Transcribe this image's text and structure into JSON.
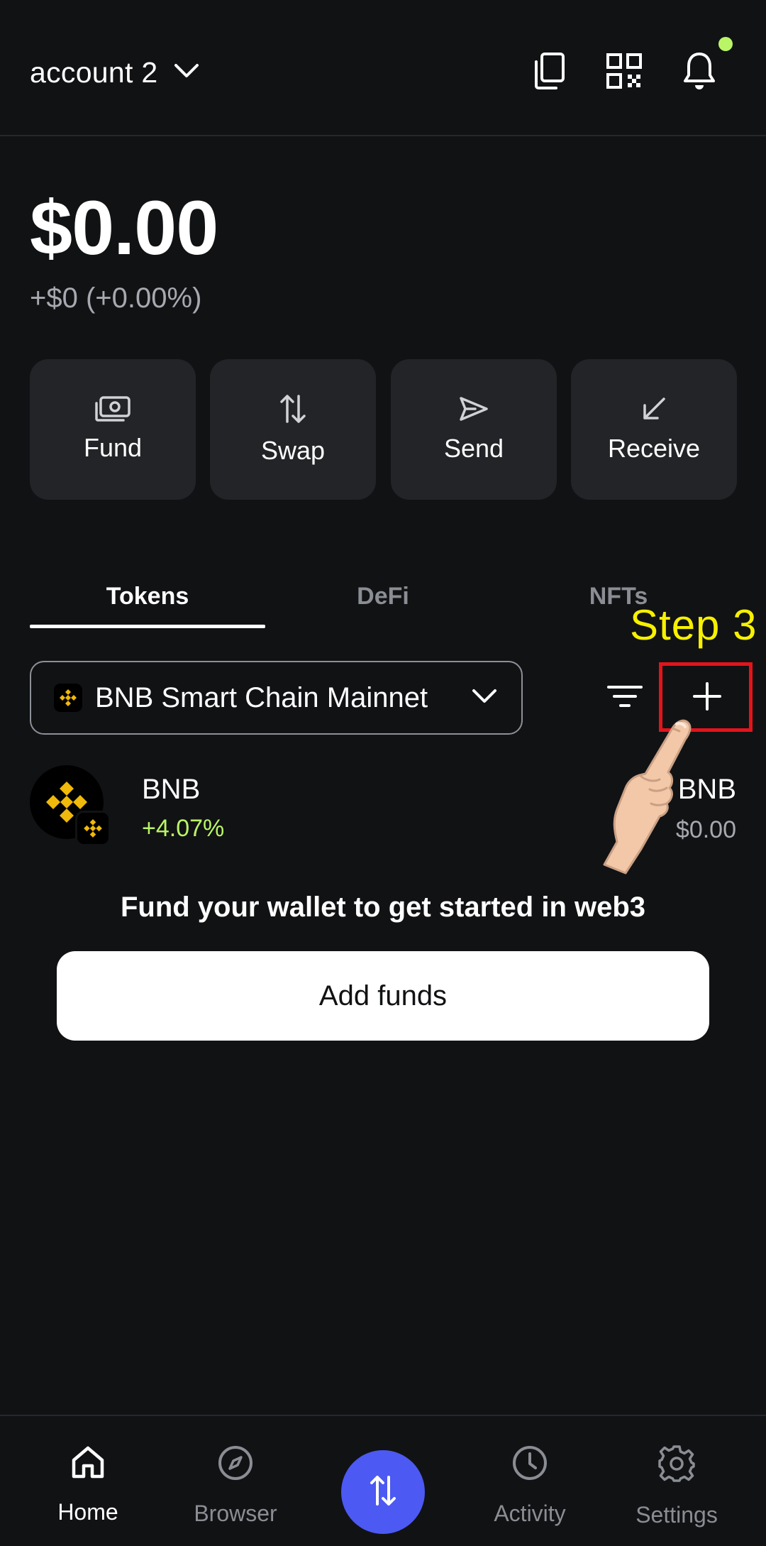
{
  "header": {
    "account_name": "account 2",
    "icons": [
      "chevron-down-icon",
      "copy-icon",
      "qr-code-icon",
      "bell-icon"
    ],
    "notification_dot_color": "#b9f566"
  },
  "balance": {
    "total": "$0.00",
    "change": "+$0 (+0.00%)"
  },
  "actions": [
    {
      "label": "Fund",
      "icon": "money-icon"
    },
    {
      "label": "Swap",
      "icon": "swap-arrows-icon"
    },
    {
      "label": "Send",
      "icon": "send-icon"
    },
    {
      "label": "Receive",
      "icon": "receive-arrow-icon"
    }
  ],
  "tabs": [
    {
      "label": "Tokens",
      "active": true
    },
    {
      "label": "DeFi",
      "active": false
    },
    {
      "label": "NFTs",
      "active": false
    }
  ],
  "network": {
    "name": "BNB Smart Chain Mainnet",
    "icon": "bnb-icon"
  },
  "toolbar": {
    "icons": [
      "filter-icon",
      "plus-icon"
    ]
  },
  "annotation": {
    "step_label": "Step 3",
    "highlight_color": "#e4141b",
    "label_color": "#f7f000"
  },
  "tokens": [
    {
      "symbol": "BNB",
      "change": "+4.07%",
      "balance": "BNB",
      "fiat": "$0.00",
      "change_color": "#b9f566"
    }
  ],
  "empty_state": {
    "prompt": "Fund your wallet to get started in web3",
    "button_label": "Add funds"
  },
  "bottom_nav": {
    "items": [
      {
        "label": "Home",
        "icon": "home-icon",
        "active": true
      },
      {
        "label": "Browser",
        "icon": "compass-icon",
        "active": false
      },
      {
        "label": "Activity",
        "icon": "clock-icon",
        "active": false
      },
      {
        "label": "Settings",
        "icon": "gear-icon",
        "active": false
      }
    ],
    "center_button_icon": "swap-arrows-icon",
    "center_button_color": "#4c59f2"
  }
}
